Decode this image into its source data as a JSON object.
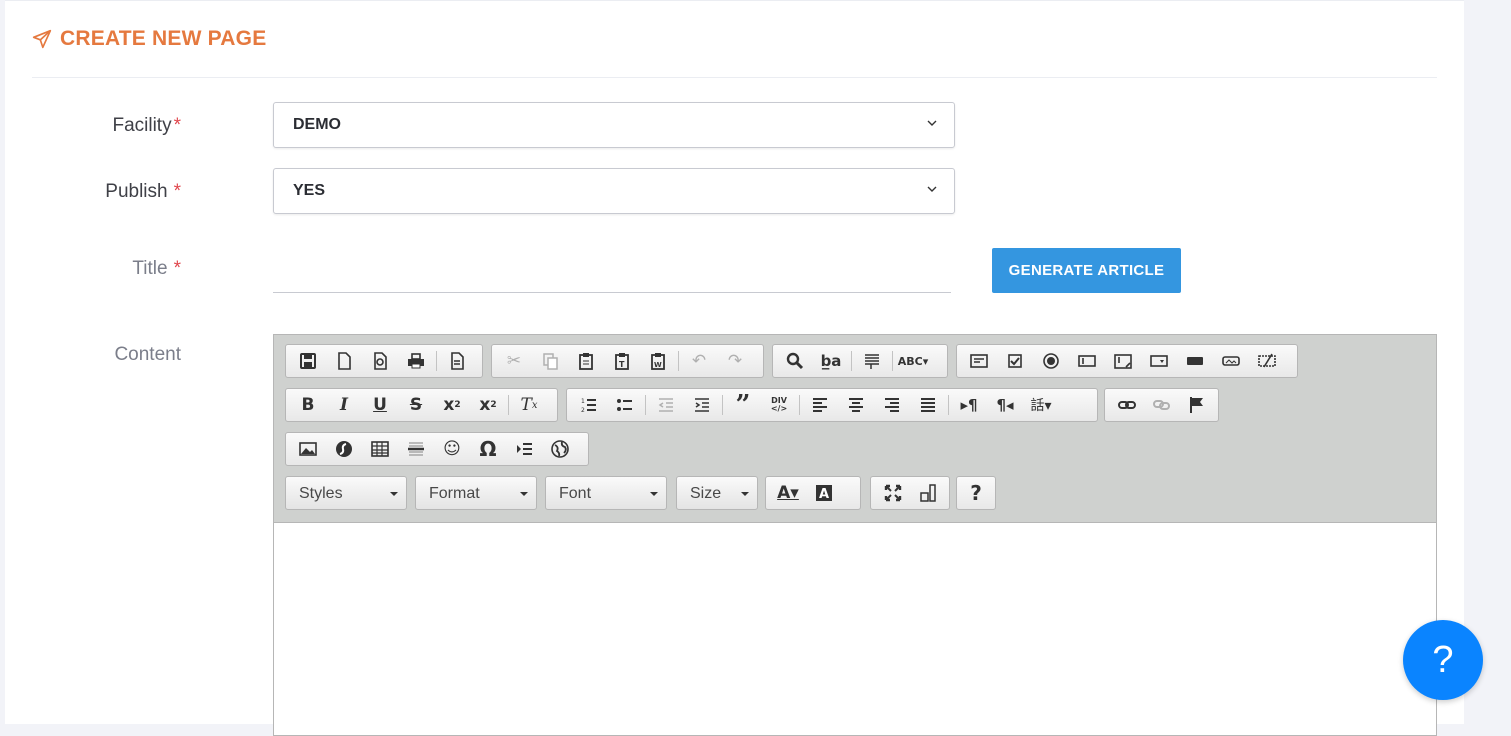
{
  "header": {
    "title": "CREATE NEW PAGE",
    "icon": "paper-plane-icon",
    "accent": "#e5793f"
  },
  "form": {
    "required_mark": "*",
    "facility": {
      "label": "Facility",
      "value": "DEMO"
    },
    "publish": {
      "label": "Publish",
      "value": "YES"
    },
    "title": {
      "label": "Title",
      "value": ""
    },
    "generate_button": "GENERATE ARTICLE",
    "content": {
      "label": "Content"
    }
  },
  "editor": {
    "combos": {
      "styles": "Styles",
      "format": "Format",
      "font": "Font",
      "size": "Size"
    },
    "help_label": "?"
  },
  "help_fab": {
    "label": "?",
    "color": "#0a84ff"
  }
}
